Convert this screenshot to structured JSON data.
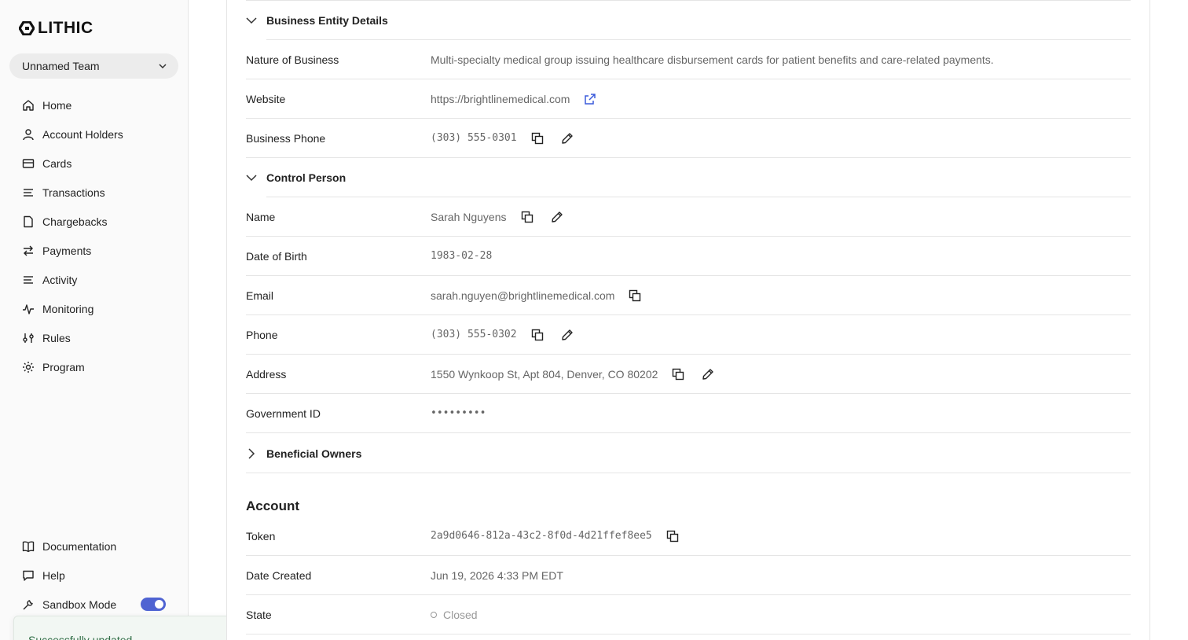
{
  "brand": {
    "name": "LITHIC"
  },
  "team": {
    "name": "Unnamed Team"
  },
  "nav": {
    "items": [
      {
        "label": "Home",
        "icon": "home-icon"
      },
      {
        "label": "Account Holders",
        "icon": "user-icon"
      },
      {
        "label": "Cards",
        "icon": "card-icon"
      },
      {
        "label": "Transactions",
        "icon": "list-icon"
      },
      {
        "label": "Chargebacks",
        "icon": "document-icon"
      },
      {
        "label": "Payments",
        "icon": "arrows-icon"
      },
      {
        "label": "Activity",
        "icon": "list-icon"
      },
      {
        "label": "Monitoring",
        "icon": "pulse-icon"
      },
      {
        "label": "Rules",
        "icon": "sliders-icon"
      },
      {
        "label": "Program",
        "icon": "gear-icon"
      }
    ],
    "bottom": [
      {
        "label": "Documentation",
        "icon": "book-icon"
      },
      {
        "label": "Help",
        "icon": "chat-icon"
      },
      {
        "label": "Sandbox Mode",
        "icon": "wrench-icon",
        "toggle_on": true
      }
    ]
  },
  "toast": {
    "message": "Successfully updated"
  },
  "business_entity": {
    "title": "Business Entity Details",
    "nature_label": "Nature of Business",
    "nature_value": "Multi-specialty medical group issuing healthcare disbursement cards for patient benefits and care-related payments.",
    "website_label": "Website",
    "website_value": "https://brightlinemedical.com",
    "phone_label": "Business Phone",
    "phone_value": "(303) 555-0301"
  },
  "control_person": {
    "title": "Control Person",
    "name_label": "Name",
    "name_value": "Sarah Nguyens",
    "dob_label": "Date of Birth",
    "dob_value": "1983-02-28",
    "email_label": "Email",
    "email_value": "sarah.nguyen@brightlinemedical.com",
    "phone_label": "Phone",
    "phone_value": "(303) 555-0302",
    "address_label": "Address",
    "address_value": "1550 Wynkoop St, Apt 804, Denver, CO 80202",
    "govid_label": "Government ID",
    "govid_value": "•••••••••"
  },
  "beneficial_owners": {
    "title": "Beneficial Owners"
  },
  "account": {
    "title": "Account",
    "token_label": "Token",
    "token_value": "2a9d0646-812a-43c2-8f0d-4d21ffef8ee5",
    "created_label": "Date Created",
    "created_value": "Jun 19, 2026 4:33 PM EDT",
    "state_label": "State",
    "state_value": "Closed"
  },
  "colors": {
    "accent": "#4f63d2",
    "link_icon": "#3b5bdb",
    "success_text": "#2f6d45"
  }
}
